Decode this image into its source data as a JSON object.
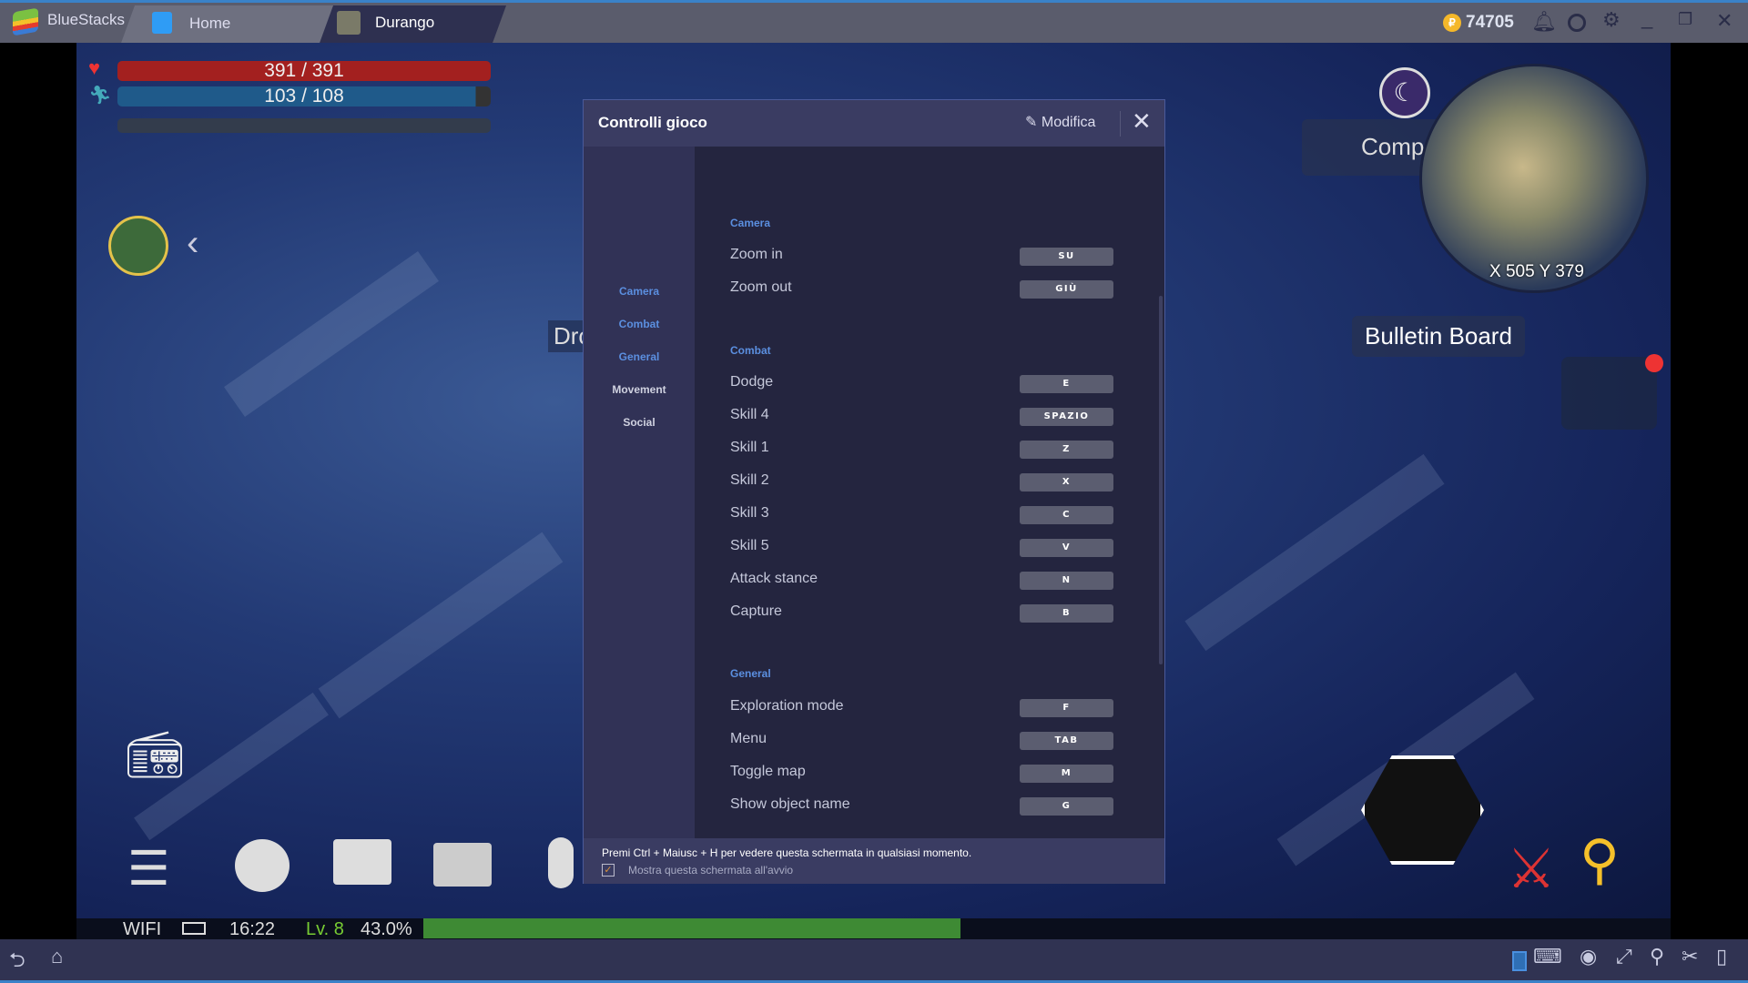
{
  "titlebar": {
    "app": "BlueStacks",
    "tabs": [
      {
        "label": "Home",
        "icon": "home-icon"
      },
      {
        "label": "Durango",
        "icon": "game-icon"
      }
    ],
    "coins": "74705"
  },
  "hud": {
    "hp": "391 / 391",
    "stamina": "103 / 108",
    "left_label": "Dro",
    "location": "Compsogna",
    "coords": "X 505 Y 379",
    "bulletin": "Bulletin Board",
    "wifi": "WIFI",
    "time": "16:22",
    "level": "Lv. 8",
    "xp": "43.0%",
    "xp_fraction": 0.43
  },
  "dialog": {
    "title": "Controlli gioco",
    "edit": "Modifica",
    "sidebar": [
      {
        "label": "Camera",
        "active": true
      },
      {
        "label": "Combat",
        "active": true
      },
      {
        "label": "General",
        "active": true
      },
      {
        "label": "Movement",
        "active": false
      },
      {
        "label": "Social",
        "active": false
      }
    ],
    "sections": [
      {
        "title": "Camera",
        "rows": [
          {
            "action": "Zoom in",
            "key": "SU"
          },
          {
            "action": "Zoom out",
            "key": "GIÙ"
          }
        ]
      },
      {
        "title": "Combat",
        "rows": [
          {
            "action": "Dodge",
            "key": "E"
          },
          {
            "action": "Skill 4",
            "key": "SPAZIO"
          },
          {
            "action": "Skill 1",
            "key": "Z"
          },
          {
            "action": "Skill 2",
            "key": "X"
          },
          {
            "action": "Skill 3",
            "key": "C"
          },
          {
            "action": "Skill 5",
            "key": "V"
          },
          {
            "action": "Attack stance",
            "key": "N"
          },
          {
            "action": "Capture",
            "key": "B"
          }
        ]
      },
      {
        "title": "General",
        "rows": [
          {
            "action": "Exploration mode",
            "key": "F"
          },
          {
            "action": "Menu",
            "key": "TAB"
          },
          {
            "action": "Toggle map",
            "key": "M"
          },
          {
            "action": "Show object name",
            "key": "G"
          }
        ]
      }
    ],
    "footer_hint": "Premi Ctrl + Maiusc + H per vedere questa schermata in qualsiasi momento.",
    "show_on_start": "Mostra questa schermata all'avvio",
    "show_on_start_checked": true
  },
  "colors": {
    "accent": "#5b8fe0",
    "hp": "#a3201f",
    "stamina": "#1f5a8a",
    "xp": "#3e8a34"
  }
}
